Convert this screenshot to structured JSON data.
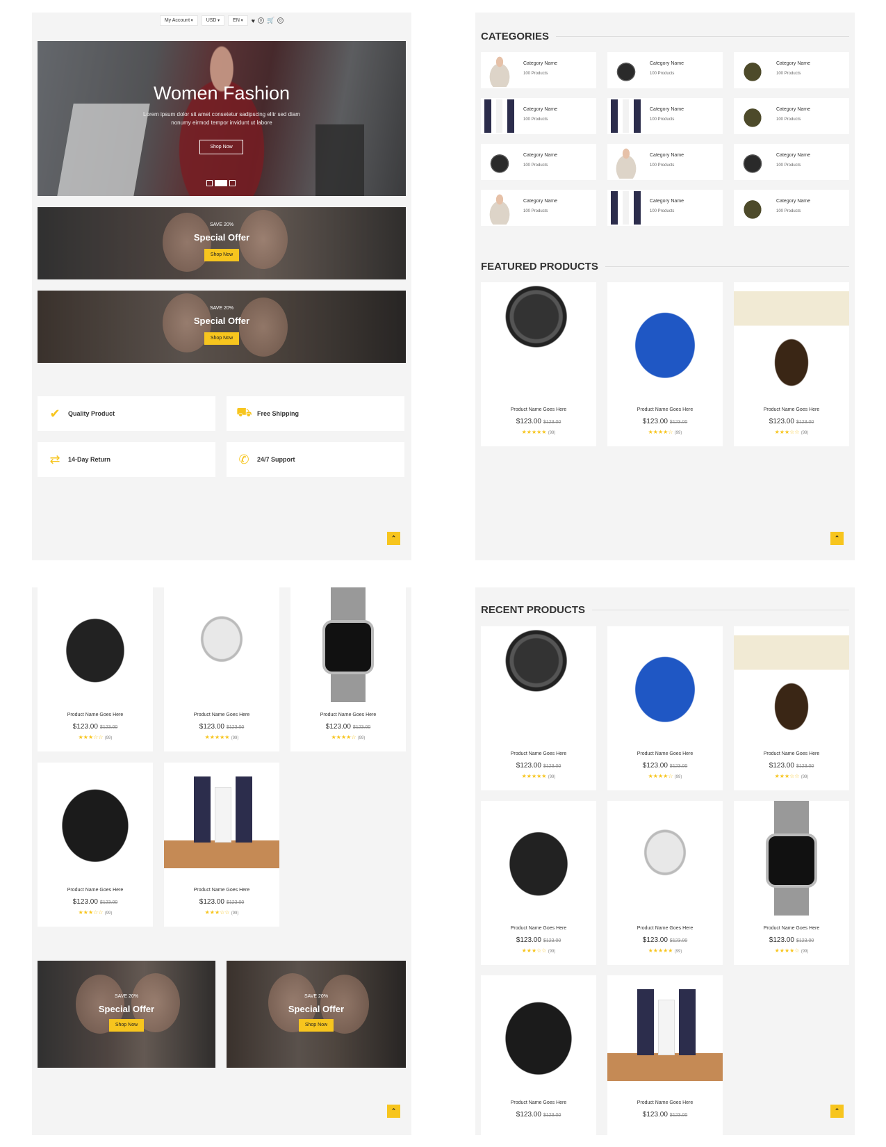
{
  "topbar": {
    "account": "My Account",
    "currency": "USD",
    "language": "EN",
    "wishlist_count": "0",
    "cart_count": "0"
  },
  "hero": {
    "title": "Women Fashion",
    "text": "Lorem ipsum dolor sit amet consetetur sadipscing elitr sed diam nonumy eirmod tempor invidunt ut labore",
    "button": "Shop Now"
  },
  "offers": [
    {
      "small": "SAVE 20%",
      "title": "Special Offer",
      "button": "Shop Now"
    },
    {
      "small": "SAVE 20%",
      "title": "Special Offer",
      "button": "Shop Now"
    },
    {
      "small": "SAVE 20%",
      "title": "Special Offer",
      "button": "Shop Now"
    },
    {
      "small": "SAVE 20%",
      "title": "Special Offer",
      "button": "Shop Now"
    }
  ],
  "features": [
    {
      "label": "Quality Product",
      "icon": "check-icon"
    },
    {
      "label": "Free Shipping",
      "icon": "truck-icon"
    },
    {
      "label": "14-Day Return",
      "icon": "exchange-icon"
    },
    {
      "label": "24/7 Support",
      "icon": "phone-icon"
    }
  ],
  "categories": {
    "heading": "CATEGORIES",
    "item_name": "Category Name",
    "item_count": "100 Products"
  },
  "featured": {
    "heading": "FEATURED PRODUCTS"
  },
  "recent": {
    "heading": "RECENT PRODUCTS"
  },
  "product": {
    "name": "Product Name Goes Here",
    "price": "$123.00",
    "old_price": "$123.00",
    "reviews": "(99)"
  },
  "colors": {
    "accent": "#f7c51e",
    "panel": "#f4f4f4"
  }
}
